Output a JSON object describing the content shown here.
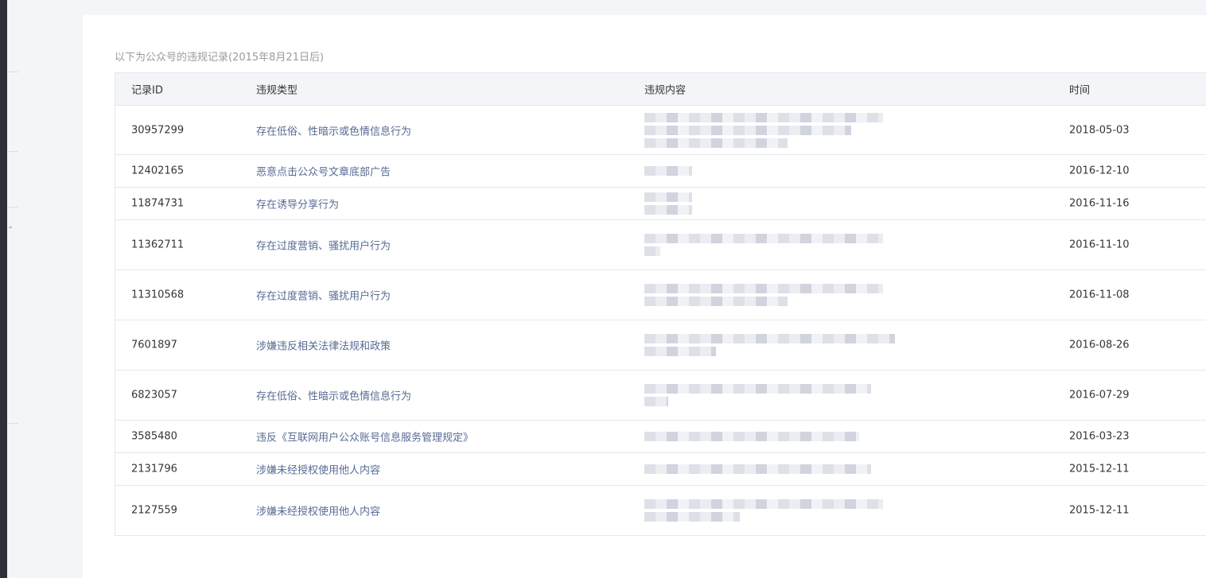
{
  "caption": "以下为公众号的违规记录(2015年8月21日后)",
  "columns": {
    "id": "记录ID",
    "type": "违规类型",
    "content": "违规内容",
    "time": "时间"
  },
  "rows": [
    {
      "id": "30957299",
      "type": "存在低俗、性暗示或色情信息行为",
      "time": "2018-05-03"
    },
    {
      "id": "12402165",
      "type": "恶意点击公众号文章底部广告",
      "time": "2016-12-10"
    },
    {
      "id": "11874731",
      "type": "存在诱导分享行为",
      "time": "2016-11-16"
    },
    {
      "id": "11362711",
      "type": "存在过度营销、骚扰用户行为",
      "time": "2016-11-10"
    },
    {
      "id": "11310568",
      "type": "存在过度营销、骚扰用户行为",
      "time": "2016-11-08"
    },
    {
      "id": "7601897",
      "type": "涉嫌违反相关法律法规和政策",
      "time": "2016-08-26"
    },
    {
      "id": "6823057",
      "type": "存在低俗、性暗示或色情信息行为",
      "time": "2016-07-29"
    },
    {
      "id": "3585480",
      "type": "违反《互联网用户公众账号信息服务管理规定》",
      "time": "2016-03-23"
    },
    {
      "id": "2131796",
      "type": "涉嫌未经授权使用他人内容",
      "time": "2015-12-11"
    },
    {
      "id": "2127559",
      "type": "涉嫌未经授权使用他人内容",
      "time": "2015-12-11"
    }
  ],
  "colors": {
    "link": "#576b95",
    "header_bg": "#f4f5f9",
    "border": "#e4e8eb",
    "caption": "#9a9a9a"
  }
}
